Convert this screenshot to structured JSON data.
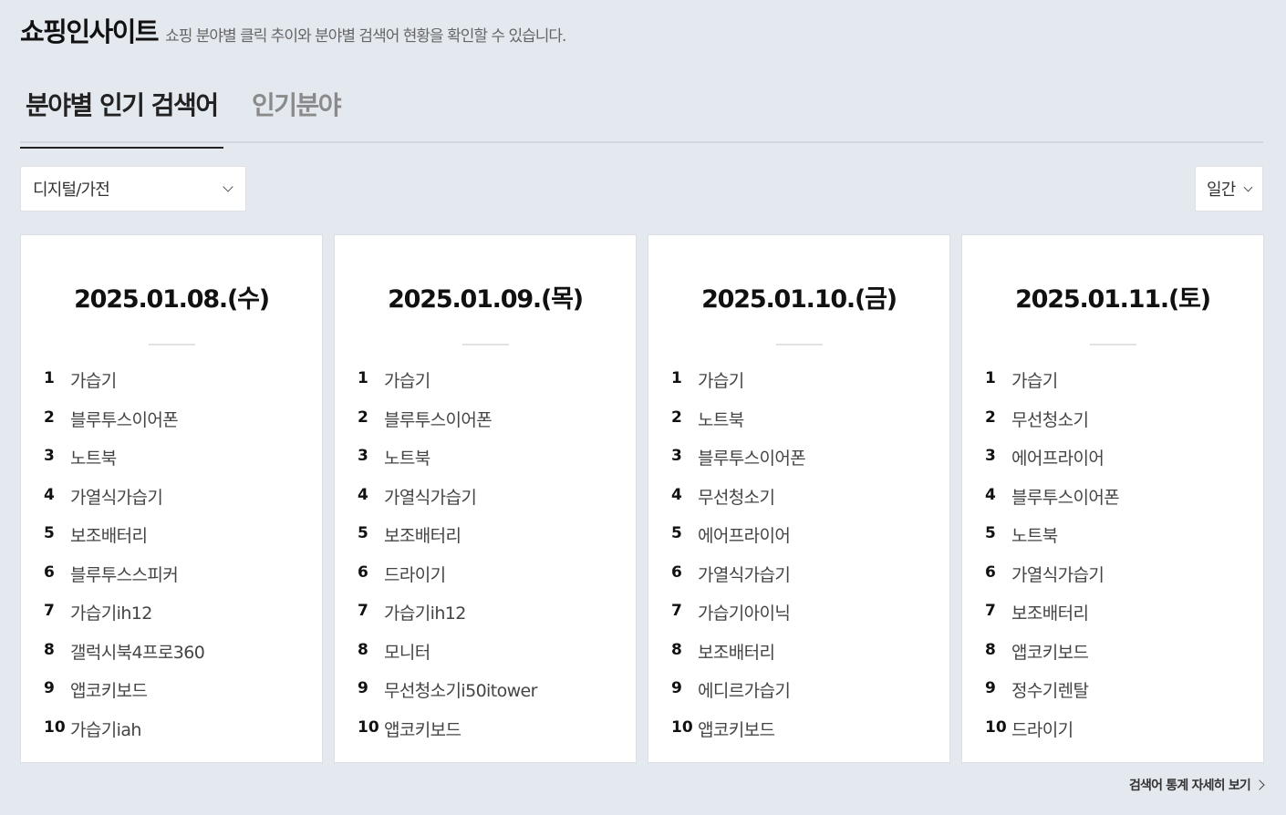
{
  "header": {
    "title": "쇼핑인사이트",
    "subtitle": "쇼핑 분야별 클릭 추이와 분야별 검색어 현황을 확인할 수 있습니다."
  },
  "tabs": [
    {
      "label": "분야별 인기 검색어",
      "active": true
    },
    {
      "label": "인기분야",
      "active": false
    }
  ],
  "filters": {
    "category": "디지털/가전",
    "period": "일간"
  },
  "cards": [
    {
      "date": "2025.01.08.(수)",
      "items": [
        {
          "rank": "1",
          "keyword": "가습기"
        },
        {
          "rank": "2",
          "keyword": "블루투스이어폰"
        },
        {
          "rank": "3",
          "keyword": "노트북"
        },
        {
          "rank": "4",
          "keyword": "가열식가습기"
        },
        {
          "rank": "5",
          "keyword": "보조배터리"
        },
        {
          "rank": "6",
          "keyword": "블루투스스피커"
        },
        {
          "rank": "7",
          "keyword": "가습기ih12"
        },
        {
          "rank": "8",
          "keyword": "갤럭시북4프로360"
        },
        {
          "rank": "9",
          "keyword": "앱코키보드"
        },
        {
          "rank": "10",
          "keyword": "가습기iah"
        }
      ]
    },
    {
      "date": "2025.01.09.(목)",
      "items": [
        {
          "rank": "1",
          "keyword": "가습기"
        },
        {
          "rank": "2",
          "keyword": "블루투스이어폰"
        },
        {
          "rank": "3",
          "keyword": "노트북"
        },
        {
          "rank": "4",
          "keyword": "가열식가습기"
        },
        {
          "rank": "5",
          "keyword": "보조배터리"
        },
        {
          "rank": "6",
          "keyword": "드라이기"
        },
        {
          "rank": "7",
          "keyword": "가습기ih12"
        },
        {
          "rank": "8",
          "keyword": "모니터"
        },
        {
          "rank": "9",
          "keyword": "무선청소기i50itower"
        },
        {
          "rank": "10",
          "keyword": "앱코키보드"
        }
      ]
    },
    {
      "date": "2025.01.10.(금)",
      "items": [
        {
          "rank": "1",
          "keyword": "가습기"
        },
        {
          "rank": "2",
          "keyword": "노트북"
        },
        {
          "rank": "3",
          "keyword": "블루투스이어폰"
        },
        {
          "rank": "4",
          "keyword": "무선청소기"
        },
        {
          "rank": "5",
          "keyword": "에어프라이어"
        },
        {
          "rank": "6",
          "keyword": "가열식가습기"
        },
        {
          "rank": "7",
          "keyword": "가습기아이닉"
        },
        {
          "rank": "8",
          "keyword": "보조배터리"
        },
        {
          "rank": "9",
          "keyword": "에디르가습기"
        },
        {
          "rank": "10",
          "keyword": "앱코키보드"
        }
      ]
    },
    {
      "date": "2025.01.11.(토)",
      "items": [
        {
          "rank": "1",
          "keyword": "가습기"
        },
        {
          "rank": "2",
          "keyword": "무선청소기"
        },
        {
          "rank": "3",
          "keyword": "에어프라이어"
        },
        {
          "rank": "4",
          "keyword": "블루투스이어폰"
        },
        {
          "rank": "5",
          "keyword": "노트북"
        },
        {
          "rank": "6",
          "keyword": "가열식가습기"
        },
        {
          "rank": "7",
          "keyword": "보조배터리"
        },
        {
          "rank": "8",
          "keyword": "앱코키보드"
        },
        {
          "rank": "9",
          "keyword": "정수기렌탈"
        },
        {
          "rank": "10",
          "keyword": "드라이기"
        }
      ]
    }
  ],
  "footer": {
    "more_label": "검색어 통계 자세히 보기"
  },
  "icons": {
    "select": "chevron-down-icon",
    "more": "chevron-right-icon"
  }
}
